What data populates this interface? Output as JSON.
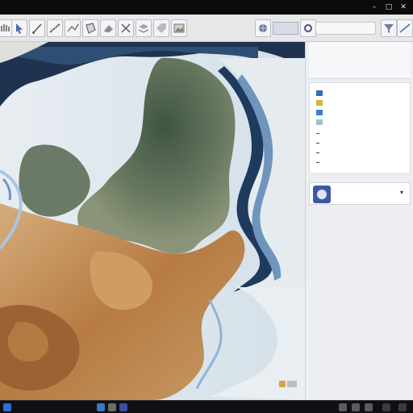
{
  "titlebar": {
    "title": "",
    "buttons": [
      "–",
      "□",
      "✕"
    ]
  },
  "toolbar": {
    "tools": [
      {
        "name": "pan-tool"
      },
      {
        "name": "select-tool"
      },
      {
        "name": "draw-tool"
      },
      {
        "name": "measure-tool"
      },
      {
        "name": "line-tool"
      },
      {
        "name": "polygon-tool"
      },
      {
        "name": "erase-tool"
      },
      {
        "name": "edit-tool"
      },
      {
        "name": "layers-tool"
      },
      {
        "name": "label-tool"
      },
      {
        "name": "export-tool"
      }
    ],
    "layer_dropdown": "",
    "search_placeholder": ""
  },
  "panel": {
    "title": "",
    "subtitle": "",
    "subtitle2": "",
    "legend": [
      {
        "label": "",
        "color": "#2f6fb5",
        "kind": "box"
      },
      {
        "label": "",
        "color": "#d8b437",
        "kind": "box"
      },
      {
        "label": "",
        "color": "#3b7fd0",
        "kind": "box"
      },
      {
        "label": "",
        "color": "#9bc2e0",
        "kind": "box"
      },
      {
        "label": "",
        "color": "#444444",
        "kind": "dash"
      },
      {
        "label": "",
        "color": "#444444",
        "kind": "dash"
      },
      {
        "label": "",
        "color": "#444444",
        "kind": "dash"
      },
      {
        "label": "",
        "color": "#444444",
        "kind": "dash"
      }
    ],
    "layer": {
      "name": "",
      "sub": ""
    }
  },
  "map": {
    "colors": {
      "ocean_deep": "#1f3350",
      "ocean_mid": "#3f6690",
      "shallow": "#b9d3e6",
      "ice": "#e9eef2",
      "forest": "#5a6b52",
      "desert": "#c08a52",
      "sand": "#d9b98c"
    },
    "scale_label": ""
  },
  "taskbar": {
    "items": [
      "",
      "",
      "",
      ""
    ]
  }
}
